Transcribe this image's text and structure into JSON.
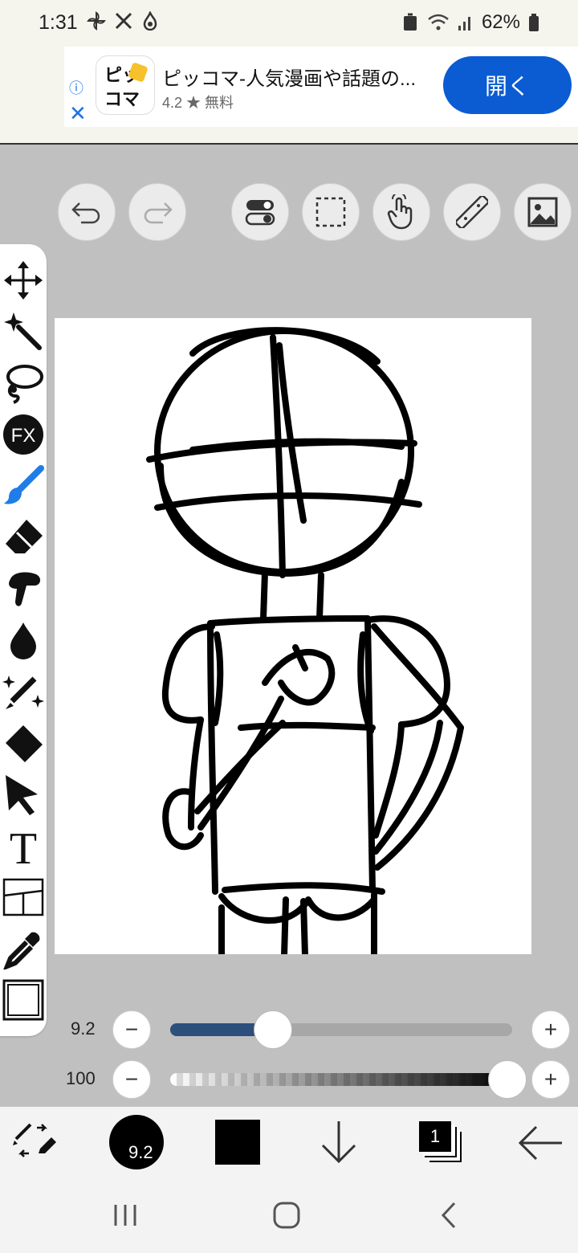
{
  "status_bar": {
    "time": "1:31",
    "battery": "62%"
  },
  "ad": {
    "logo_top": "ピッ",
    "logo_bottom": "コマ",
    "title": "ピッコマ-人気漫画や話題の...",
    "rating": "4.2 ★ 無料",
    "open_button": "開く"
  },
  "brush": {
    "size_label": "9.2",
    "size_fraction": 0.3,
    "opacity_label": "100",
    "opacity_fraction": 1.0
  },
  "bottom_bar": {
    "brush_size": "9.2",
    "layer_count": "1"
  },
  "sliders": {
    "minus": "−",
    "plus": "+"
  },
  "colors": {
    "accent": "#0b5bd3",
    "active_tool": "#1e7de6",
    "slider_fill": "#2c4f7b"
  }
}
